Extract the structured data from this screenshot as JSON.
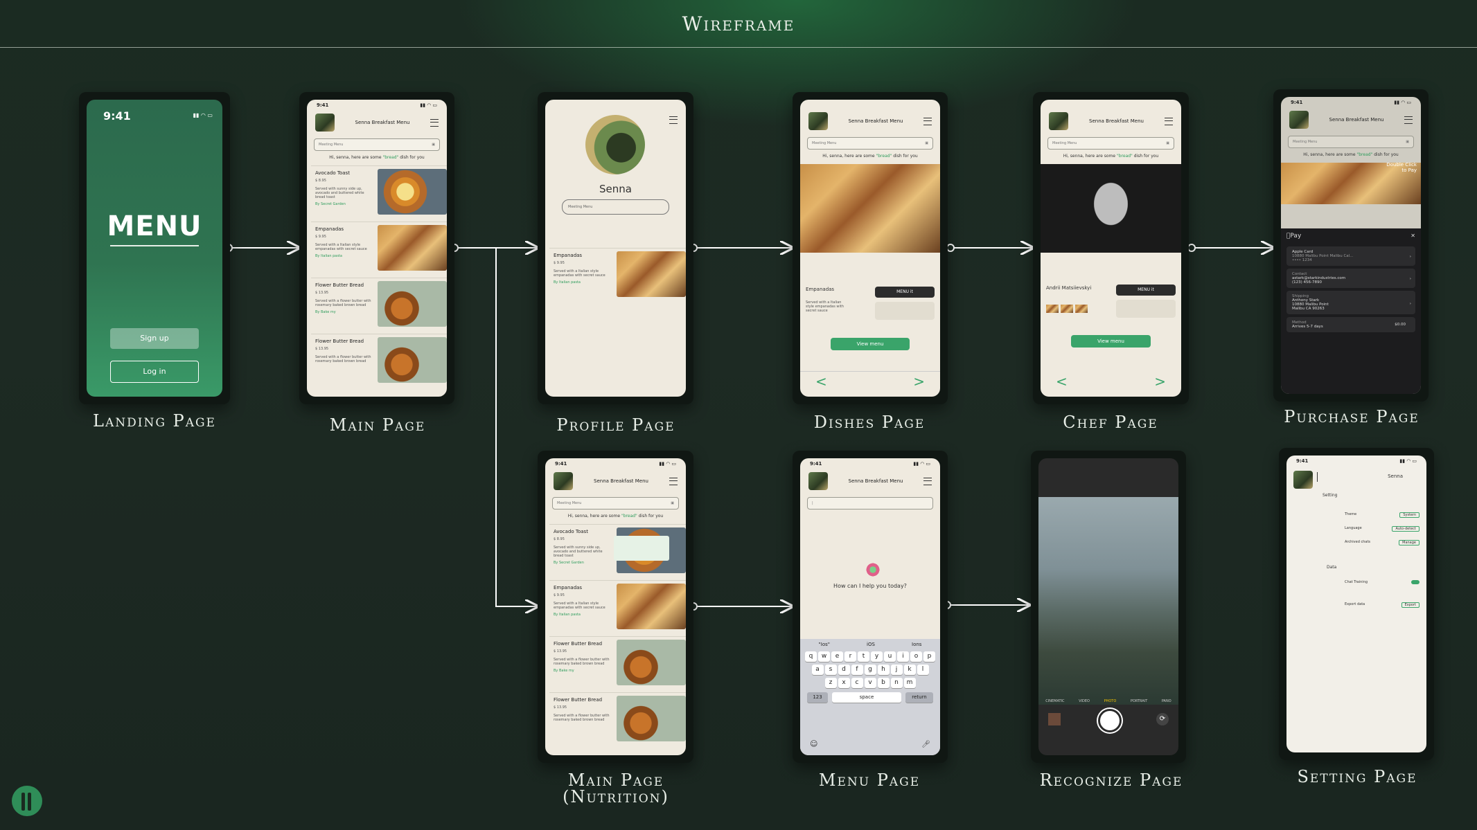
{
  "title": "Wireframe",
  "labels": {
    "landing": "Landing Page",
    "main": "Main Page",
    "profile": "Profile Page",
    "dishes": "Dishes Page",
    "chef": "Chef Page",
    "purchase": "Purchase Page",
    "main_nutrition_1": "Main Page",
    "main_nutrition_2": "(Nutrition)",
    "menu": "Menu Page",
    "recognize": "Recognize Page",
    "setting": "Setting Page"
  },
  "landing": {
    "time": "9:41",
    "heading": "MENU",
    "signup": "Sign up",
    "login": "Log in"
  },
  "common": {
    "time": "9:41",
    "brand": "Senna Breakfast Menu",
    "search_placeholder": "Meeting Menu",
    "greeting_pre": "Hi, senna, here are some",
    "greeting_word": "\"bread\"",
    "greeting_post": "dish for you"
  },
  "dishes": [
    {
      "name": "Avocado Toast",
      "price": "$ 8.95",
      "desc": "Served with sunny side up, avocado and buttered white bread toast",
      "tag": "By Secret Garden"
    },
    {
      "name": "Empanadas",
      "price": "$ 9.95",
      "desc": "Served with a Italian style empanadas with secret sauce",
      "tag": "By Italian pasta"
    },
    {
      "name": "Flower Butter Bread",
      "price": "$ 13.95",
      "desc": "Served with a flower butter with rosemary baked brown bread",
      "tag": "By Bake my"
    },
    {
      "name": "Flower Butter Bread",
      "price": "$ 13.95",
      "desc": "Served with a flower butter with rosemary baked brown bread",
      "tag": "By Bake my"
    }
  ],
  "profile": {
    "name": "Senna",
    "field": "Meeting Menu"
  },
  "dish_page": {
    "dish": "Empanadas",
    "menu_btn": "MENU it",
    "view_btn": "View menu"
  },
  "chef_page": {
    "name": "Andrii Matsiievskyi",
    "menu_btn": "MENU it",
    "view_btn": "View menu"
  },
  "purchase": {
    "overlay": "Double Click to Pay",
    "pay": "Pay",
    "card_name": "Apple Card",
    "card_addr": "10880 Malibu Point Malibu Cal...",
    "card_num": "•••• 1234",
    "contact_label": "Contact",
    "contact_email": "astark@starkindustries.com",
    "contact_phone": "(123) 456-7890",
    "ship_label": "Shipping",
    "ship_name": "Anthony Stark",
    "ship_addr1": "10880 Malibu Point",
    "ship_addr2": "Malibu CA 90263",
    "method_label": "Method",
    "method_val": "Arrives 5-7 days",
    "method_price": "$0.00"
  },
  "menu_page": {
    "prompt": "How can I help you today?",
    "suggest": [
      "\"Ios\"",
      "iOS",
      "Ions"
    ],
    "rows": [
      [
        "q",
        "w",
        "e",
        "r",
        "t",
        "y",
        "u",
        "i",
        "o",
        "p"
      ],
      [
        "a",
        "s",
        "d",
        "f",
        "g",
        "h",
        "j",
        "k",
        "l"
      ],
      [
        "z",
        "x",
        "c",
        "v",
        "b",
        "n",
        "m"
      ]
    ],
    "k123": "123",
    "space": "space",
    "return": "return"
  },
  "recognize": {
    "modes": [
      "CINEMATIC",
      "VIDEO",
      "PHOTO",
      "PORTRAIT",
      "PANO"
    ]
  },
  "setting": {
    "time": "9:41",
    "name": "Senna",
    "setting_h": "Setting",
    "theme": "Theme",
    "theme_v": "System",
    "language": "Language",
    "language_v": "Auto-detect",
    "archived": "Archived chats",
    "archived_v": "Manage",
    "data_h": "Data",
    "chat_training": "Chat Training",
    "export": "Export data",
    "export_v": "Export"
  },
  "colors": {
    "accent": "#3aa46a",
    "bg": "#1b2a22",
    "screen": "#efeadf"
  }
}
